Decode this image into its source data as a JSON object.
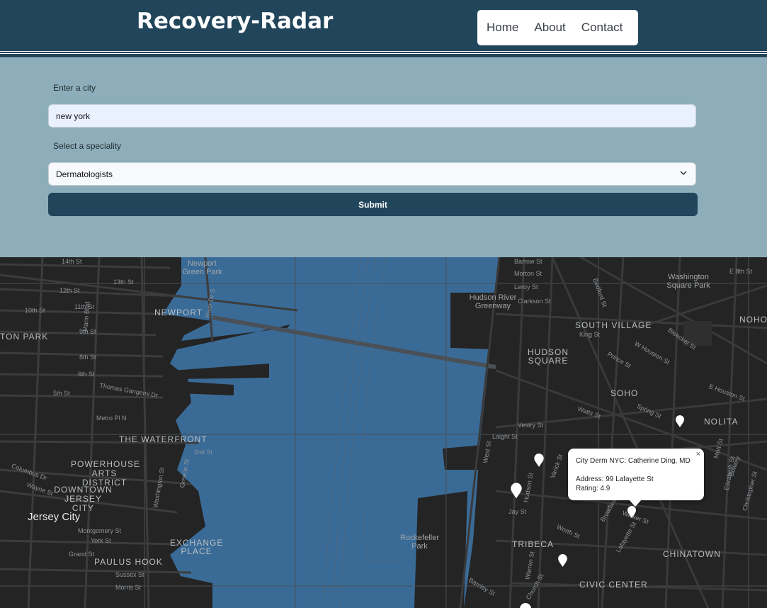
{
  "header": {
    "brand": "Recovery-Radar",
    "nav": [
      "Home",
      "About",
      "Contact"
    ]
  },
  "form": {
    "city_label": "Enter a city",
    "city_value": "new york",
    "speciality_label": "Select a speciality",
    "speciality_value": "Dermatologists",
    "submit_label": "Submit"
  },
  "map": {
    "area_labels": [
      "NEWPORT",
      "TON PARK",
      "THE WATERFRONT",
      "POWERHOUSE ARTS DISTRICT",
      "DOWNTOWN JERSEY CITY",
      "Jersey City",
      "EXCHANGE PLACE",
      "PAULUS HOOK",
      "HUDSON SQUARE",
      "SOUTH VILLAGE",
      "SOHO",
      "NOLITA",
      "TRIBECA",
      "CHINATOWN",
      "CIVIC CENTER",
      "NOHO",
      "Washington Square Park",
      "Hudson River Greenway",
      "Newport Green Park",
      "Rockefeller Park"
    ],
    "street_labels": [
      "14th St",
      "12th St",
      "13th St",
      "11th St",
      "10th St",
      "9th St",
      "8th St",
      "6th St",
      "5th St",
      "Marin Blvd",
      "Thomas Gangemi Dr",
      "Metro Pl N",
      "2nd St",
      "Columbus Dr",
      "Wayne St",
      "Greene St",
      "Washington St",
      "Montgomery St",
      "York St",
      "Grand St",
      "Sussex St",
      "Morris St",
      "Hudson St",
      "Varick St",
      "Jay St",
      "Worth St",
      "Church St",
      "Barclay St",
      "Broadway",
      "Lafayette St",
      "Walker St",
      "Spring St",
      "Watts St",
      "Laight St",
      "Vestry St",
      "West St",
      "King St",
      "E Houston St",
      "W Houston St",
      "Prince St",
      "Bleecker St",
      "Bowery",
      "Mott St",
      "Elizabeth St",
      "Barrow St",
      "Morton St",
      "Leroy St",
      "Clarkson St",
      "Bedford St",
      "E 8th St",
      "River Dr S",
      "Warren St",
      "Christopher St"
    ],
    "popup": {
      "title": "City Derm NYC: Catherine Ding, MD",
      "address": "Address: 99 Lafayette St",
      "rating": "Rating: 4.9",
      "close": "×"
    },
    "colors": {
      "water": "#3a6b97",
      "land": "#242424",
      "roads": "#3a3a3a"
    }
  }
}
